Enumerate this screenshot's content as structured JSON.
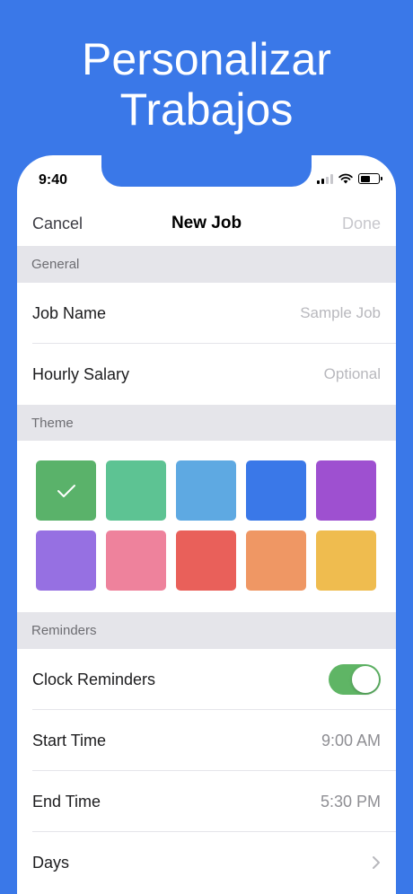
{
  "promo": {
    "line1": "Personalizar",
    "line2": "Trabajos"
  },
  "status_bar": {
    "time": "9:40",
    "icons": [
      "signal-icon",
      "wifi-icon",
      "battery-icon"
    ]
  },
  "navbar": {
    "cancel_label": "Cancel",
    "title": "New Job",
    "done_label": "Done"
  },
  "sections": {
    "general": "General",
    "theme": "Theme",
    "reminders": "Reminders"
  },
  "general": {
    "job_name_label": "Job Name",
    "job_name_placeholder": "Sample Job",
    "hourly_salary_label": "Hourly Salary",
    "hourly_salary_placeholder": "Optional"
  },
  "theme": {
    "selected_index": 0,
    "colors": [
      "#5ab26a",
      "#5dc393",
      "#5ea9e2",
      "#3a78e8",
      "#9e50d0",
      "#9670e2",
      "#ee829c",
      "#e9605a",
      "#ef9764",
      "#efbc4f"
    ]
  },
  "reminders": {
    "clock_reminders_label": "Clock Reminders",
    "clock_reminders_on": true,
    "start_time_label": "Start Time",
    "start_time_value": "9:00 AM",
    "end_time_label": "End Time",
    "end_time_value": "5:30 PM",
    "days_label": "Days"
  }
}
